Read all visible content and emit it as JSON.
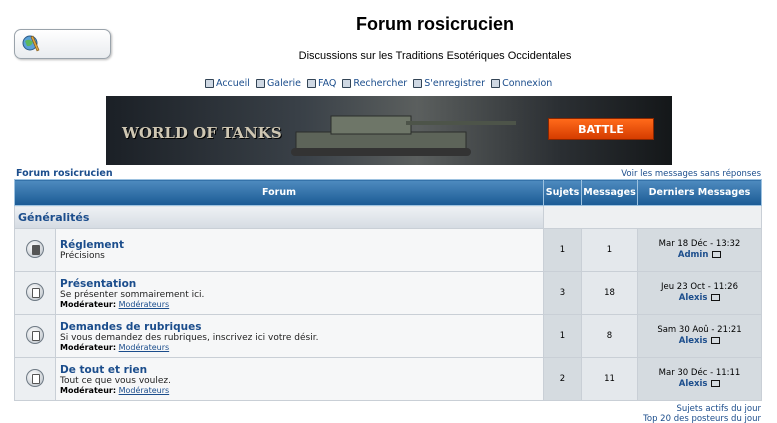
{
  "site": {
    "title": "Forum rosicrucien",
    "description": "Discussions sur les Traditions Esotériques Occidentales"
  },
  "nav": [
    {
      "icon": "home-icon",
      "label": "Accueil"
    },
    {
      "icon": "gallery-icon",
      "label": "Galerie"
    },
    {
      "icon": "faq-icon",
      "label": "FAQ"
    },
    {
      "icon": "search-icon",
      "label": "Rechercher"
    },
    {
      "icon": "register-icon",
      "label": "S'enregistrer"
    },
    {
      "icon": "login-icon",
      "label": "Connexion"
    }
  ],
  "banner": {
    "brand": "WORLD OF TANKS",
    "cta": "BATTLE"
  },
  "breadcrumb": "Forum rosicrucien",
  "unanswered_link": "Voir les messages sans réponses",
  "table": {
    "headers": {
      "forum": "Forum",
      "topics": "Sujets",
      "posts": "Messages",
      "last": "Derniers Messages"
    },
    "category": "Généralités",
    "forums": [
      {
        "status": "locked",
        "title": "Réglement",
        "description": "Précisions",
        "moderator_label": "",
        "moderator": "",
        "topics": "1",
        "posts": "1",
        "last_date": "Mar 18 Déc - 13:32",
        "last_author": "Admin"
      },
      {
        "status": "normal",
        "title": "Présentation",
        "description": "Se présenter sommairement ici.",
        "moderator_label": "Modérateur:",
        "moderator": "Modérateurs",
        "topics": "3",
        "posts": "18",
        "last_date": "Jeu 23 Oct - 11:26",
        "last_author": "Alexis"
      },
      {
        "status": "normal",
        "title": "Demandes de rubriques",
        "description": "Si vous demandez des rubriques, inscrivez ici votre désir.",
        "moderator_label": "Modérateur:",
        "moderator": "Modérateurs",
        "topics": "1",
        "posts": "8",
        "last_date": "Sam 30 Aoû - 21:21",
        "last_author": "Alexis"
      },
      {
        "status": "normal",
        "title": "De tout et rien",
        "description": "Tout ce que vous voulez.",
        "moderator_label": "Modérateur:",
        "moderator": "Modérateurs",
        "topics": "2",
        "posts": "11",
        "last_date": "Mar 30 Déc - 11:11",
        "last_author": "Alexis"
      }
    ]
  },
  "footer_links": [
    "Sujets actifs du jour",
    "Top 20 des posteurs du jour"
  ]
}
